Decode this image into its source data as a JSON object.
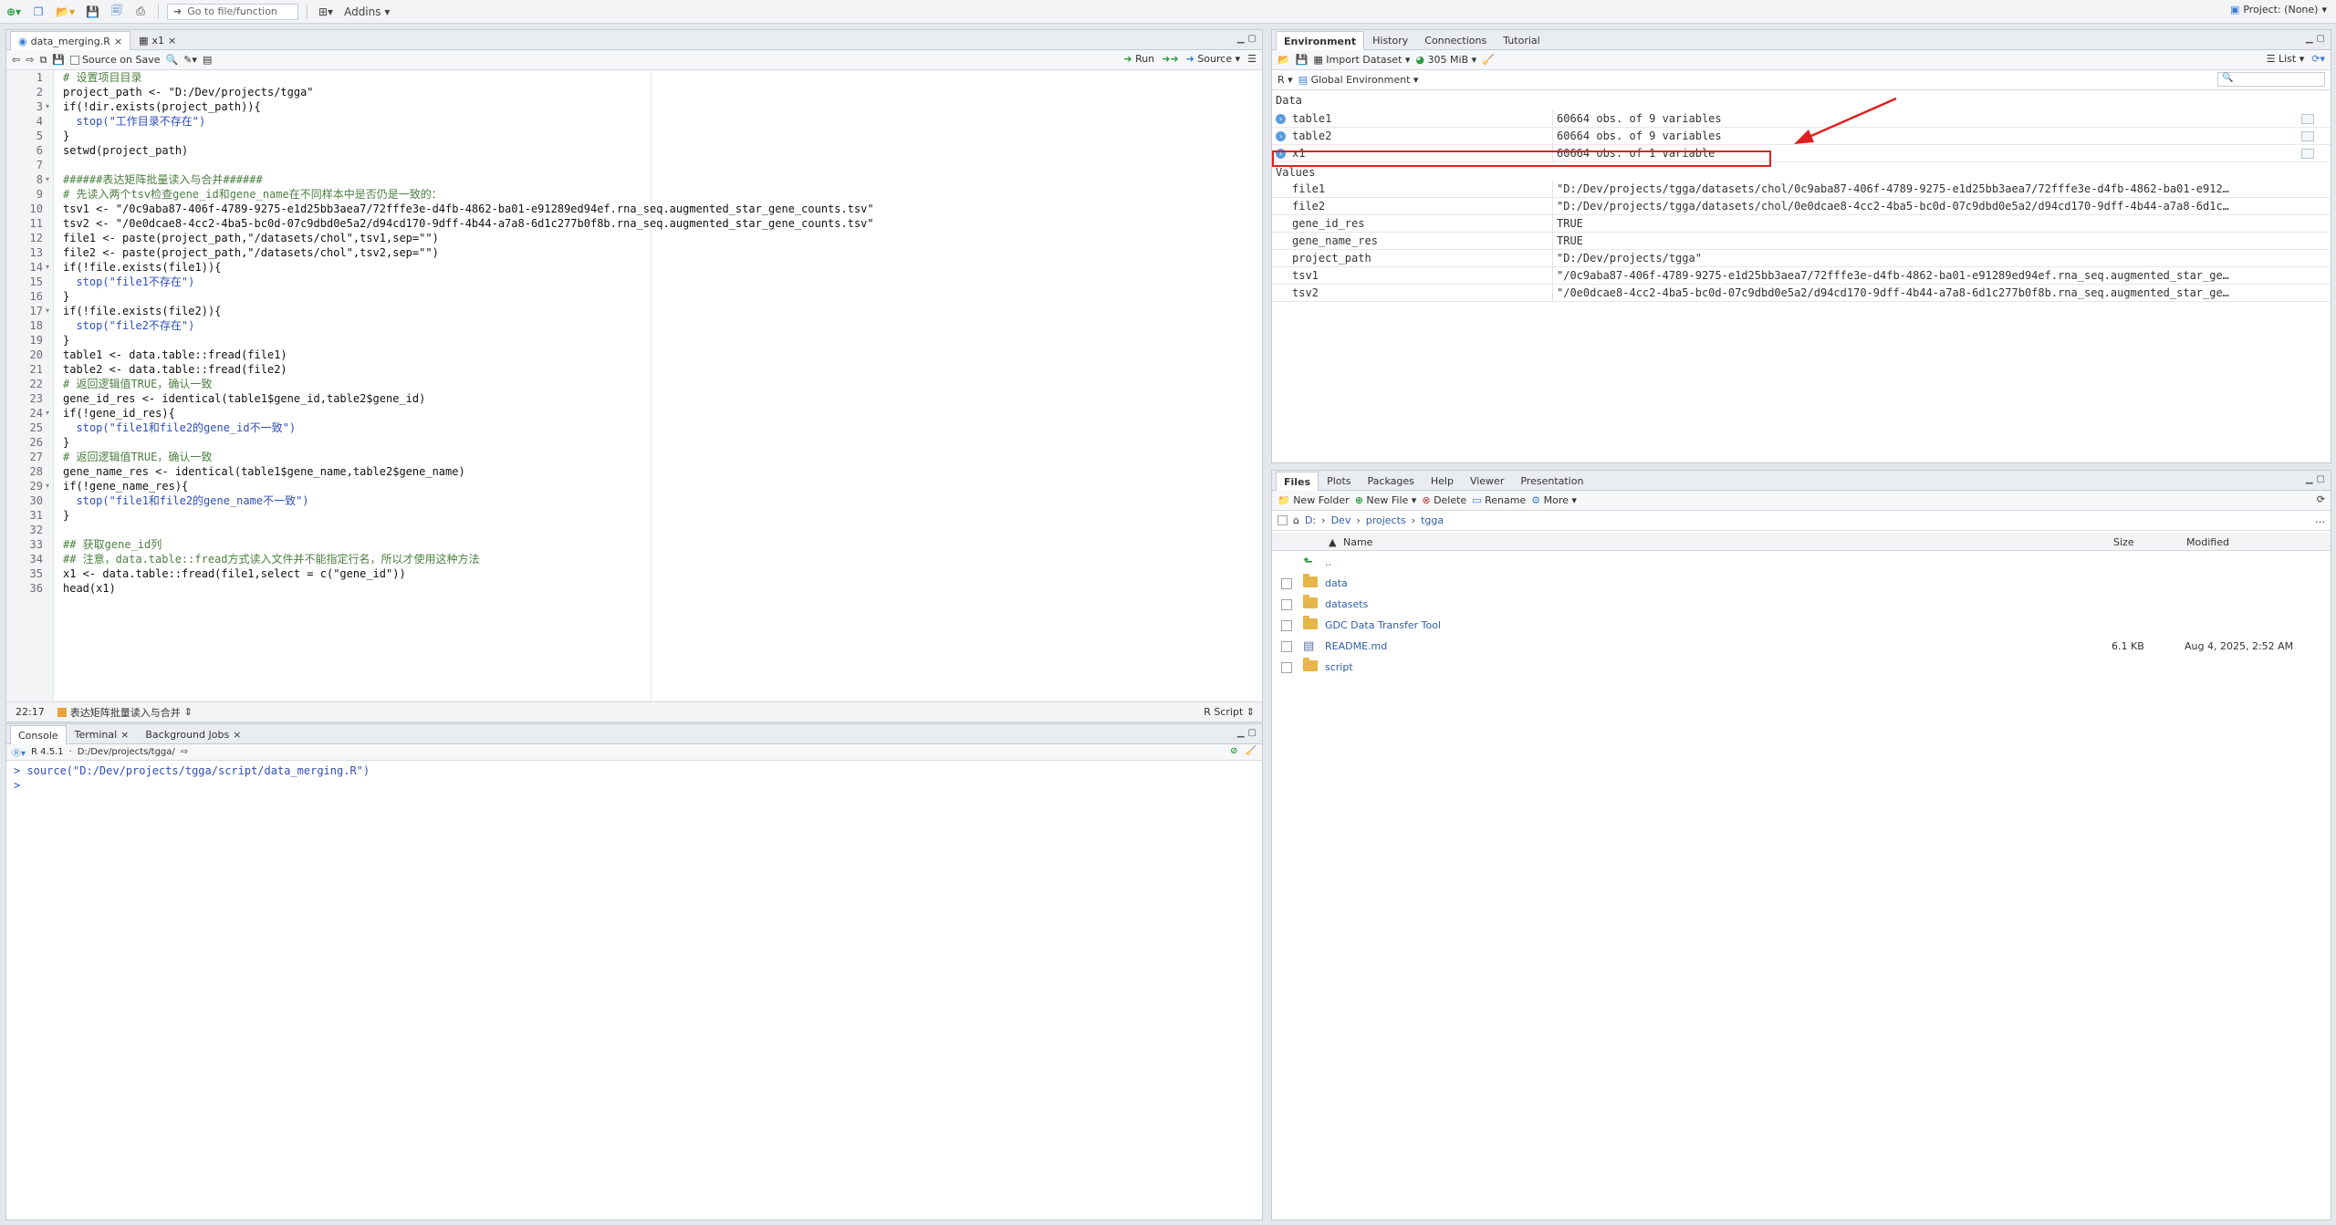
{
  "toolbar": {
    "goto_placeholder": "Go to file/function",
    "addins_label": "Addins",
    "project_label": "Project: (None)"
  },
  "editor": {
    "tabs": [
      {
        "label": "data_merging.R",
        "active": true
      },
      {
        "label": "x1",
        "active": false
      }
    ],
    "source_on_save": "Source on Save",
    "run_label": "Run",
    "source_label": "Source",
    "status_position": "22:17",
    "status_section": "表达矩阵批量读入与合并",
    "status_filetype": "R Script",
    "lines": [
      "# 设置项目目录",
      "project_path <- \"D:/Dev/projects/tgga\"",
      "if(!dir.exists(project_path)){",
      "  stop(\"工作目录不存在\")",
      "}",
      "setwd(project_path)",
      "",
      "######表达矩阵批量读入与合并######",
      "# 先读入两个tsv检查gene_id和gene_name在不同样本中是否仍是一致的：",
      "tsv1 <- \"/0c9aba87-406f-4789-9275-e1d25bb3aea7/72fffe3e-d4fb-4862-ba01-e91289ed94ef.rna_seq.augmented_star_gene_counts.tsv\"",
      "tsv2 <- \"/0e0dcae8-4cc2-4ba5-bc0d-07c9dbd0e5a2/d94cd170-9dff-4b44-a7a8-6d1c277b0f8b.rna_seq.augmented_star_gene_counts.tsv\"",
      "file1 <- paste(project_path,\"/datasets/chol\",tsv1,sep=\"\")",
      "file2 <- paste(project_path,\"/datasets/chol\",tsv2,sep=\"\")",
      "if(!file.exists(file1)){",
      "  stop(\"file1不存在\")",
      "}",
      "if(!file.exists(file2)){",
      "  stop(\"file2不存在\")",
      "}",
      "table1 <- data.table::fread(file1)",
      "table2 <- data.table::fread(file2)",
      "# 返回逻辑值TRUE，确认一致",
      "gene_id_res <- identical(table1$gene_id,table2$gene_id)",
      "if(!gene_id_res){",
      "  stop(\"file1和file2的gene_id不一致\")",
      "}",
      "# 返回逻辑值TRUE，确认一致",
      "gene_name_res <- identical(table1$gene_name,table2$gene_name)",
      "if(!gene_name_res){",
      "  stop(\"file1和file2的gene_name不一致\")",
      "}",
      "",
      "## 获取gene_id列",
      "## 注意，data.table::fread方式读入文件并不能指定行名，所以才使用这种方法",
      "x1 <- data.table::fread(file1,select = c(\"gene_id\"))",
      "head(x1)"
    ]
  },
  "console": {
    "tabs": [
      "Console",
      "Terminal",
      "Background Jobs"
    ],
    "r_version": "R 4.5.1",
    "wd": "D:/Dev/projects/tgga/",
    "lines": [
      "> source(\"D:/Dev/projects/tgga/script/data_merging.R\")",
      "> "
    ]
  },
  "environment": {
    "tabs": [
      "Environment",
      "History",
      "Connections",
      "Tutorial"
    ],
    "import_label": "Import Dataset",
    "memory_label": "305 MiB",
    "list_label": "List",
    "lang_label": "R",
    "scope_label": "Global Environment",
    "data_header": "Data",
    "values_header": "Values",
    "data": [
      {
        "name": "table1",
        "value": "60664 obs. of 9 variables"
      },
      {
        "name": "table2",
        "value": "60664 obs. of 9 variables"
      },
      {
        "name": "x1",
        "value": "60664 obs. of 1 variable"
      }
    ],
    "values": [
      {
        "name": "file1",
        "value": "\"D:/Dev/projects/tgga/datasets/chol/0c9aba87-406f-4789-9275-e1d25bb3aea7/72fffe3e-d4fb-4862-ba01-e912…"
      },
      {
        "name": "file2",
        "value": "\"D:/Dev/projects/tgga/datasets/chol/0e0dcae8-4cc2-4ba5-bc0d-07c9dbd0e5a2/d94cd170-9dff-4b44-a7a8-6d1c…"
      },
      {
        "name": "gene_id_res",
        "value": "TRUE"
      },
      {
        "name": "gene_name_res",
        "value": "TRUE"
      },
      {
        "name": "project_path",
        "value": "\"D:/Dev/projects/tgga\""
      },
      {
        "name": "tsv1",
        "value": "\"/0c9aba87-406f-4789-9275-e1d25bb3aea7/72fffe3e-d4fb-4862-ba01-e91289ed94ef.rna_seq.augmented_star_ge…"
      },
      {
        "name": "tsv2",
        "value": "\"/0e0dcae8-4cc2-4ba5-bc0d-07c9dbd0e5a2/d94cd170-9dff-4b44-a7a8-6d1c277b0f8b.rna_seq.augmented_star_ge…"
      }
    ]
  },
  "files": {
    "tabs": [
      "Files",
      "Plots",
      "Packages",
      "Help",
      "Viewer",
      "Presentation"
    ],
    "new_folder": "New Folder",
    "new_file": "New File",
    "delete": "Delete",
    "rename": "Rename",
    "more": "More",
    "breadcrumb": [
      "D:",
      "Dev",
      "projects",
      "tgga"
    ],
    "col_name": "Name",
    "col_size": "Size",
    "col_modified": "Modified",
    "up_label": "..",
    "items": [
      {
        "name": "data",
        "type": "folder",
        "size": "",
        "modified": ""
      },
      {
        "name": "datasets",
        "type": "folder",
        "size": "",
        "modified": ""
      },
      {
        "name": "GDC Data Transfer Tool",
        "type": "folder",
        "size": "",
        "modified": ""
      },
      {
        "name": "README.md",
        "type": "md",
        "size": "6.1 KB",
        "modified": "Aug 4, 2025, 2:52 AM"
      },
      {
        "name": "script",
        "type": "folder",
        "size": "",
        "modified": ""
      }
    ]
  }
}
